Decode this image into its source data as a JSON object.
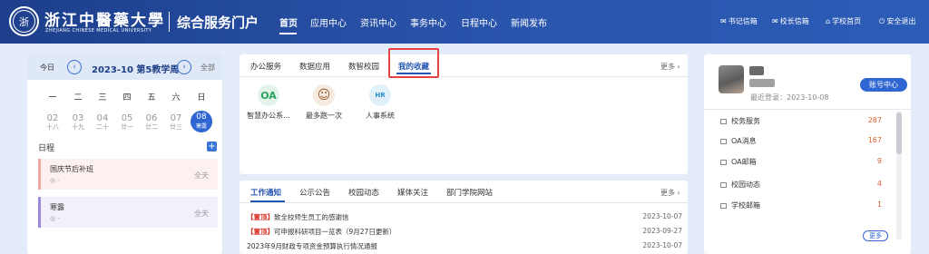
{
  "header": {
    "school_cn": "浙江中醫藥大學",
    "school_en": "ZHEJIANG CHINESE MEDICAL UNIVERSITY",
    "logo_glyph": "浙",
    "portal_title": "综合服务门户",
    "nav": [
      "首页",
      "应用中心",
      "资讯中心",
      "事务中心",
      "日程中心",
      "新闻发布"
    ],
    "tools": [
      {
        "icon": "mail-icon",
        "glyph": "✉",
        "label": "书记信箱"
      },
      {
        "icon": "mail-icon",
        "glyph": "✉",
        "label": "校长信箱"
      },
      {
        "icon": "home-icon",
        "glyph": "⌂",
        "label": "学校首页"
      },
      {
        "icon": "logout-icon",
        "glyph": "⏻",
        "label": "安全退出"
      }
    ],
    "background": "#2a55ad"
  },
  "calendar": {
    "today": "今日",
    "prev": "‹",
    "next": "›",
    "week_title": "2023-10 第5教学周",
    "all": "全部",
    "weekdays": [
      "一",
      "二",
      "三",
      "四",
      "五",
      "六",
      "日"
    ],
    "days": [
      {
        "n": "02",
        "l": "十八"
      },
      {
        "n": "03",
        "l": "十九"
      },
      {
        "n": "04",
        "l": "二十"
      },
      {
        "n": "05",
        "l": "廿一"
      },
      {
        "n": "06",
        "l": "廿二"
      },
      {
        "n": "07",
        "l": "廿三"
      },
      {
        "n": "08",
        "l": "寒露"
      }
    ],
    "selected_day": "08",
    "schedule_title": "日程",
    "add": "+",
    "events": [
      {
        "title": "国庆节后补班",
        "loc": "◎ -",
        "allday": "全天",
        "color": "#f0a9a0",
        "bg": "#fdf1ef"
      },
      {
        "title": "寒露",
        "loc": "◎ -",
        "allday": "全天",
        "color": "#9b8ad8",
        "bg": "#f3f0fb"
      }
    ]
  },
  "favorites": {
    "tabs": [
      "办公服务",
      "数据应用",
      "数智校园",
      "我的收藏"
    ],
    "selected_tab": "我的收藏",
    "more": "更多 ›",
    "apps": [
      {
        "icon": "oa-icon",
        "glyph": "OA",
        "label": "智慧办公系...",
        "bg": "#e3f3ea",
        "fg": "#27a360"
      },
      {
        "icon": "person-run-icon",
        "glyph": "☺",
        "label": "最多跑一次",
        "bg": "#f6ebe0",
        "fg": "#9a5a2b"
      },
      {
        "icon": "hr-system-icon",
        "glyph": "HR",
        "label": "人事系统",
        "bg": "#e0f1fa",
        "fg": "#2a8ec9"
      }
    ]
  },
  "news": {
    "tabs": [
      "工作通知",
      "公示公告",
      "校园动态",
      "媒体关注",
      "部门学院网站"
    ],
    "selected_tab": "工作通知",
    "more": "更多 ›",
    "rows": [
      {
        "tag": "【置顶】",
        "title": "致全校师生员工的感谢信",
        "date": "2023-10-07"
      },
      {
        "tag": "【置顶】",
        "title": "可申报科研项目一览表（9月27日更新）",
        "date": "2023-09-27"
      },
      {
        "tag": "",
        "title": "2023年9月财政专项资金预算执行情况通报",
        "date": "2023-10-07"
      }
    ]
  },
  "user": {
    "last_login": "最近登录：2023-10-08",
    "account_button": "账号中心",
    "items": [
      {
        "label": "校务服务",
        "count": "287"
      },
      {
        "label": "OA消息",
        "count": "167"
      },
      {
        "label": "OA邮箱",
        "count": "9"
      },
      {
        "label": "校园动态",
        "count": "4"
      },
      {
        "label": "学校邮箱",
        "count": "1"
      }
    ],
    "more": "更多"
  }
}
